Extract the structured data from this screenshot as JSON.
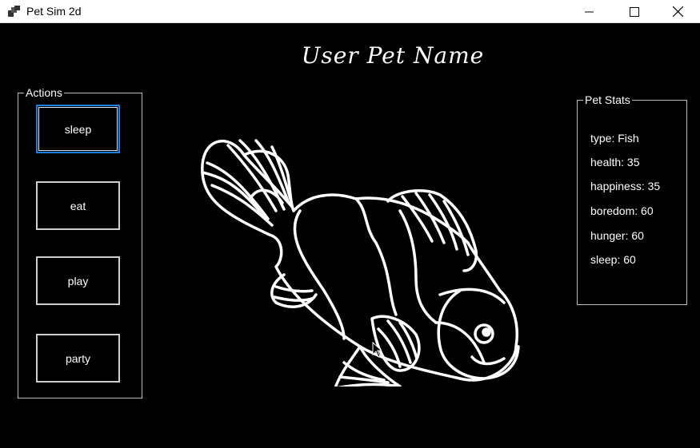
{
  "window": {
    "title": "Pet Sim 2d",
    "icons": {
      "app": "app-window-icon",
      "minimize": "minimize-icon",
      "maximize": "maximize-icon",
      "close": "close-icon"
    }
  },
  "header": {
    "pet_name": "User Pet Name"
  },
  "actions": {
    "legend": "Actions",
    "buttons": [
      {
        "label": "sleep",
        "focused": true
      },
      {
        "label": "eat"
      },
      {
        "label": "play"
      },
      {
        "label": "party"
      }
    ]
  },
  "stats": {
    "legend": "Pet Stats",
    "rows": [
      {
        "text": "type: Fish"
      },
      {
        "text": "health: 35"
      },
      {
        "text": "happiness: 35"
      },
      {
        "text": "boredom: 60"
      },
      {
        "text": "hunger: 60"
      },
      {
        "text": "sleep: 60"
      }
    ]
  },
  "pet_image": {
    "depicts": "clownfish-outline",
    "icon": "fish-icon"
  },
  "colors": {
    "background": "#000000",
    "foreground": "#ffffff",
    "focus_border": "#1e7fe0",
    "box_border": "#bdbdbd"
  }
}
